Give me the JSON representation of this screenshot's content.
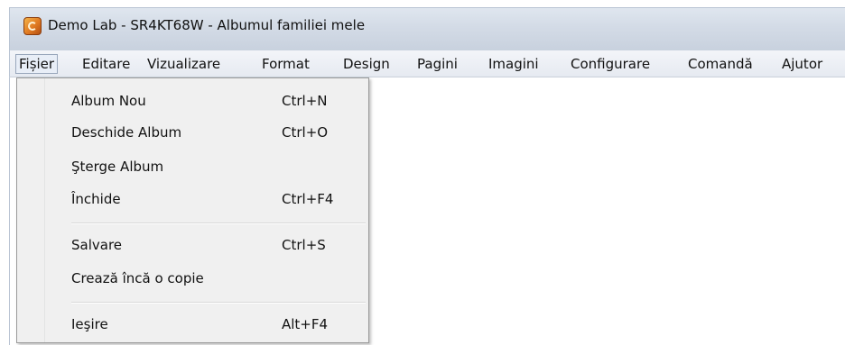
{
  "window": {
    "title": "Demo Lab - SR4KT68W - Albumul familiei mele",
    "icon": "app-logo-icon"
  },
  "menubar": {
    "items": [
      {
        "label": "Fișier",
        "active": true
      },
      {
        "label": "Editare"
      },
      {
        "label": "Vizualizare"
      },
      {
        "label": "Format"
      },
      {
        "label": "Design"
      },
      {
        "label": "Pagini"
      },
      {
        "label": "Imagini"
      },
      {
        "label": "Configurare"
      },
      {
        "label": "Comandă"
      },
      {
        "label": "Ajutor"
      }
    ]
  },
  "file_menu": {
    "items": [
      {
        "label": "Album Nou",
        "shortcut": "Ctrl+N"
      },
      {
        "label": "Deschide Album",
        "shortcut": "Ctrl+O"
      },
      {
        "label": "Şterge Album",
        "shortcut": ""
      },
      {
        "label": "Închide",
        "shortcut": "Ctrl+F4"
      },
      {
        "label": "Salvare",
        "shortcut": "Ctrl+S"
      },
      {
        "label": "Crează încă o copie",
        "shortcut": ""
      },
      {
        "label": "Ieşire",
        "shortcut": "Alt+F4"
      }
    ]
  },
  "colors": {
    "titlebar": "#d3dbe6",
    "menu_background": "#f0f0f0",
    "active_menu_border": "#9aa8bc"
  }
}
